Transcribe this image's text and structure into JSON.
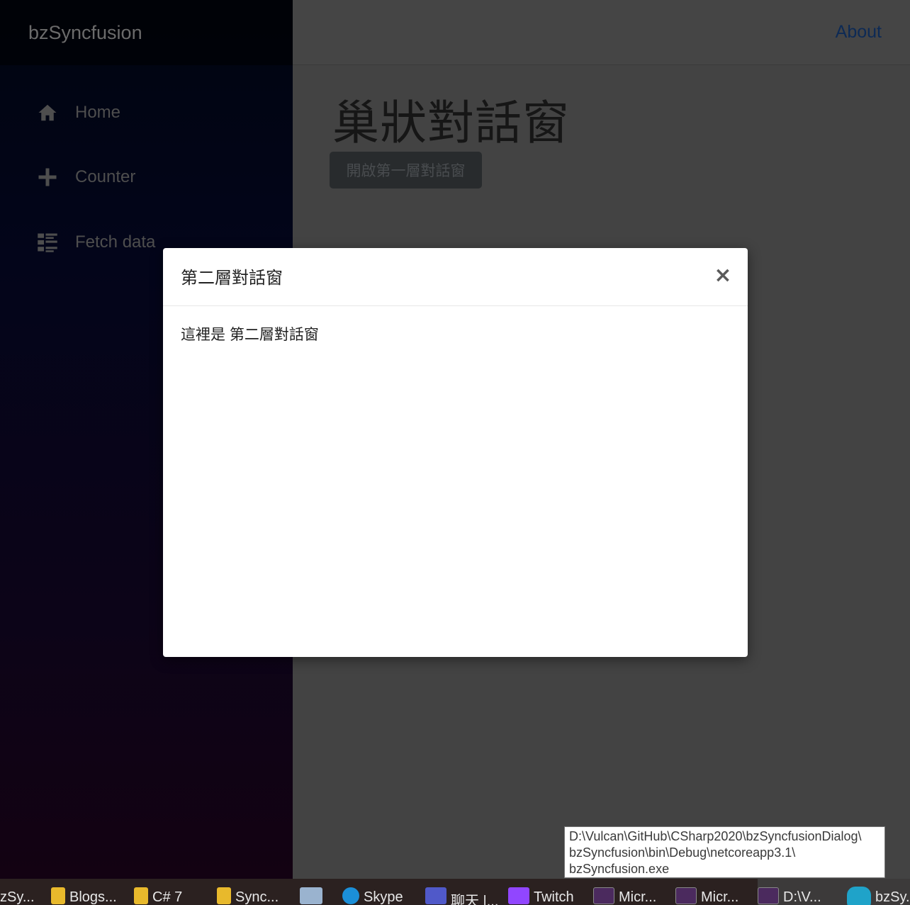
{
  "app": {
    "brand": "bzSyncfusion"
  },
  "sidebar": {
    "items": [
      {
        "label": "Home",
        "icon": "home-icon"
      },
      {
        "label": "Counter",
        "icon": "plus-icon"
      },
      {
        "label": "Fetch data",
        "icon": "list-icon"
      }
    ]
  },
  "header": {
    "about_label": "About"
  },
  "main": {
    "title": "巢狀對話窗",
    "open_button_label": "開啟第一層對話窗"
  },
  "modal": {
    "title": "第二層對話窗",
    "close_symbol": "×",
    "body": "這裡是 第二層對話窗"
  },
  "tooltip": {
    "lines": [
      "D:\\Vulcan\\GitHub\\CSharp2020\\bzSyncfusionDialog\\",
      "bzSyncfusion\\bin\\Debug\\netcoreapp3.1\\",
      "bzSyncfusion.exe"
    ]
  },
  "taskbar": {
    "items": [
      {
        "label": "zSy...",
        "icon": "none"
      },
      {
        "label": "Blogs...",
        "icon": "folder-icon"
      },
      {
        "label": "C# 7",
        "icon": "folder-icon"
      },
      {
        "label": "Sync...",
        "icon": "folder-icon"
      },
      {
        "label": "",
        "icon": "monitor-icon"
      },
      {
        "label": "Skype",
        "icon": "skype-icon"
      },
      {
        "label": "聊天 |...",
        "icon": "teams-icon"
      },
      {
        "label": "Twitch",
        "icon": "twitch-icon"
      },
      {
        "label": "Micr...",
        "icon": "console-icon"
      },
      {
        "label": "Micr...",
        "icon": "console-icon"
      },
      {
        "label": "D:\\V...",
        "icon": "console-icon"
      },
      {
        "label": "bzSy...",
        "icon": "edge-icon"
      }
    ]
  },
  "colors": {
    "overlay_background": "#434343",
    "modal_background": "#ffffff",
    "about_link": "#0d2a55",
    "taskbar_background": "#2b2120"
  }
}
